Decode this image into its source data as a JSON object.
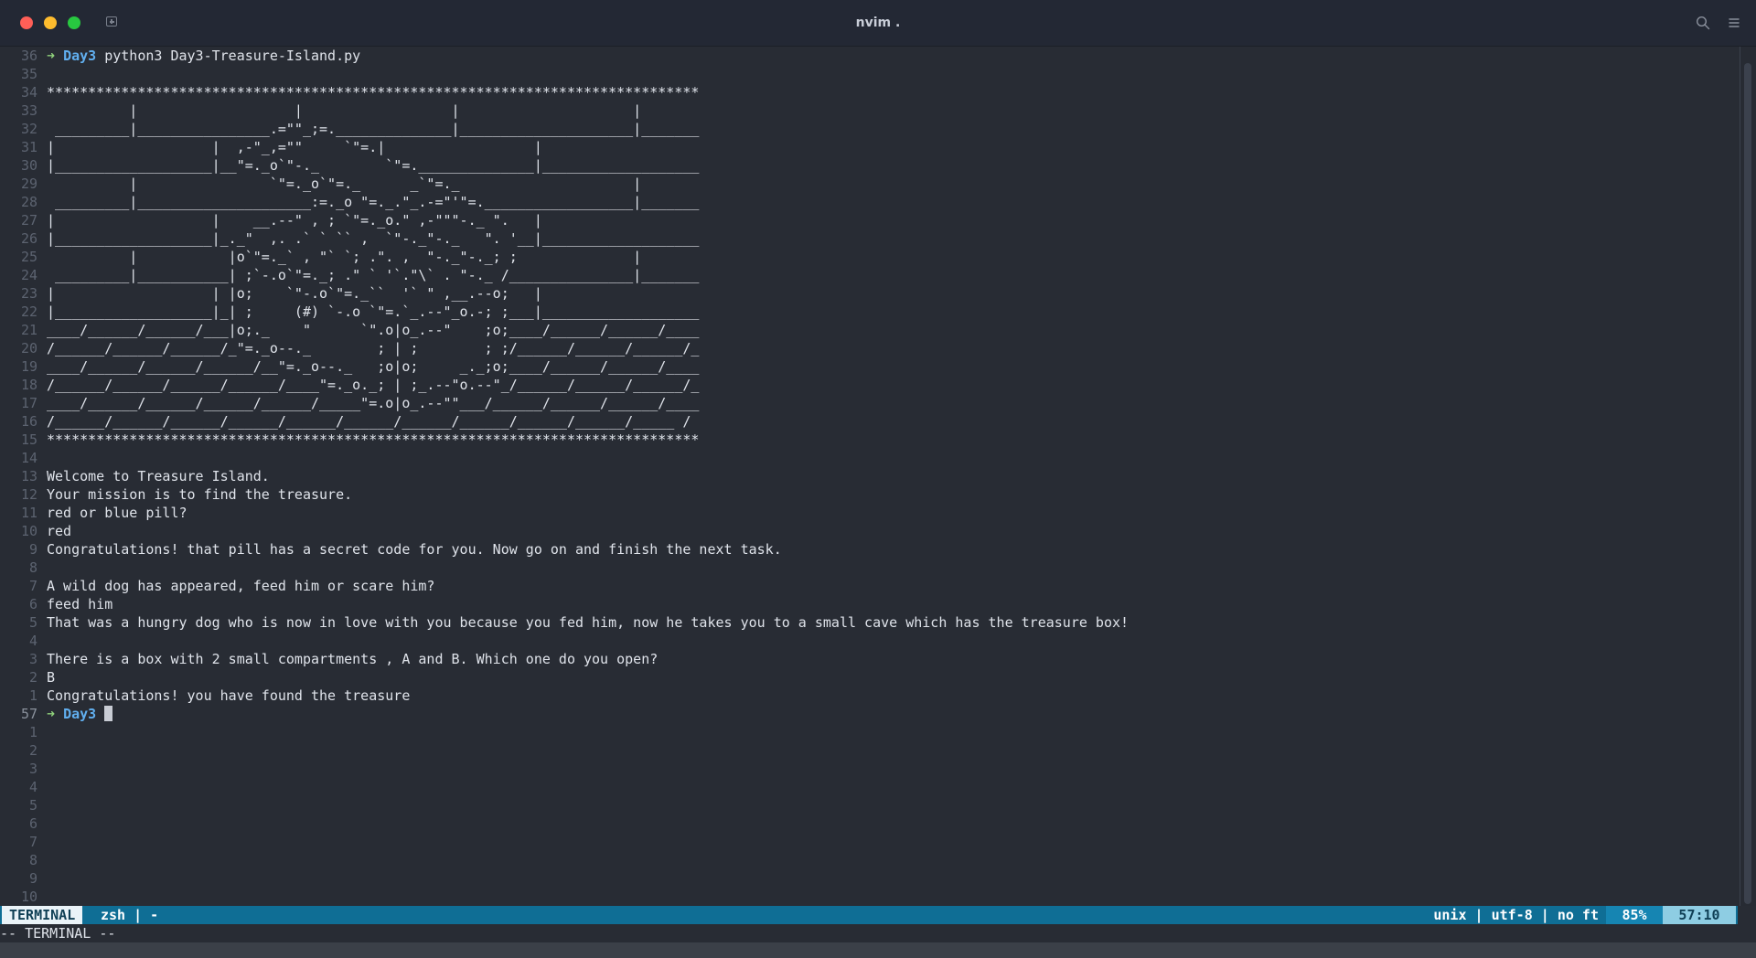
{
  "window": {
    "title": "nvim ."
  },
  "icons": {
    "close": "close-dot",
    "minimize": "minimize-dot",
    "maximize": "maximize-dot",
    "new_tab": "new-tab-icon",
    "search": "search-icon",
    "menu": "hamburger-menu-icon"
  },
  "colors": {
    "background": "#282c34",
    "prompt_arrow": "#8fd17b",
    "prompt_dir": "#61afef",
    "statusline": "#0f6e95"
  },
  "terminal": {
    "lines": [
      {
        "n": "36",
        "prompt": true,
        "arrow": "➜",
        "dir": "Day3",
        "text": "python3 Day3-Treasure-Island.py"
      },
      {
        "n": "35",
        "text": ""
      },
      {
        "n": "34",
        "text": "*******************************************************************************"
      },
      {
        "n": "33",
        "text": "          |                   |                  |                     |"
      },
      {
        "n": "32",
        "text": " _________|________________.=\"\"_;=.______________|_____________________|_______"
      },
      {
        "n": "31",
        "text": "|                   |  ,-\"_,=\"\"     `\"=.|                  |"
      },
      {
        "n": "30",
        "text": "|___________________|__\"=._o`\"-._        `\"=.______________|___________________"
      },
      {
        "n": "29",
        "text": "          |                `\"=._o`\"=._      _`\"=._                     |"
      },
      {
        "n": "28",
        "text": " _________|_____________________:=._o \"=._.\"_.-=\"'\"=.__________________|_______"
      },
      {
        "n": "27",
        "text": "|                   |    __.--\" , ; `\"=._o.\" ,-\"\"\"-._ \".   |"
      },
      {
        "n": "26",
        "text": "|___________________|_._\"  ,. .` ` `` ,  `\"-._\"-._   \". '__|___________________"
      },
      {
        "n": "25",
        "text": "          |           |o`\"=._` , \"` `; .\". ,  \"-._\"-._; ;              |"
      },
      {
        "n": "24",
        "text": " _________|___________| ;`-.o`\"=._; .\" ` '`.\"\\` . \"-._ /_______________|_______"
      },
      {
        "n": "23",
        "text": "|                   | |o;    `\"-.o`\"=._``  '` \" ,__.--o;   |"
      },
      {
        "n": "22",
        "text": "|___________________|_| ;     (#) `-.o `\"=.`_.--\"_o.-; ;___|___________________"
      },
      {
        "n": "21",
        "text": "____/______/______/___|o;._    \"      `\".o|o_.--\"    ;o;____/______/______/____"
      },
      {
        "n": "20",
        "text": "/______/______/______/_\"=._o--._        ; | ;        ; ;/______/______/______/_"
      },
      {
        "n": "19",
        "text": "____/______/______/______/__\"=._o--._   ;o|o;     _._;o;____/______/______/____"
      },
      {
        "n": "18",
        "text": "/______/______/______/______/____\"=._o._; | ;_.--\"o.--\"_/______/______/______/_"
      },
      {
        "n": "17",
        "text": "____/______/______/______/______/_____\"=.o|o_.--\"\"___/______/______/______/____"
      },
      {
        "n": "16",
        "text": "/______/______/______/______/______/______/______/______/______/______/_____ /"
      },
      {
        "n": "15",
        "text": "*******************************************************************************"
      },
      {
        "n": "14",
        "text": ""
      },
      {
        "n": "13",
        "text": "Welcome to Treasure Island."
      },
      {
        "n": "12",
        "text": "Your mission is to find the treasure."
      },
      {
        "n": "11",
        "text": "red or blue pill?"
      },
      {
        "n": "10",
        "text": "red"
      },
      {
        "n": "9",
        "text": "Congratulations! that pill has a secret code for you. Now go on and finish the next task."
      },
      {
        "n": "8",
        "text": ""
      },
      {
        "n": "7",
        "text": "A wild dog has appeared, feed him or scare him?"
      },
      {
        "n": "6",
        "text": "feed him"
      },
      {
        "n": "5",
        "text": "That was a hungry dog who is now in love with you because you fed him, now he takes you to a small cave which has the treasure box!"
      },
      {
        "n": "4",
        "text": ""
      },
      {
        "n": "3",
        "text": "There is a box with 2 small compartments , A and B. Which one do you open?"
      },
      {
        "n": "2",
        "text": "B"
      },
      {
        "n": "1",
        "text": "Congratulations! you have found the treasure"
      },
      {
        "n": "57",
        "prompt": true,
        "current": true,
        "arrow": "➜",
        "dir": "Day3",
        "text": ""
      },
      {
        "n": "1",
        "text": ""
      },
      {
        "n": "2",
        "text": ""
      },
      {
        "n": "3",
        "text": ""
      },
      {
        "n": "4",
        "text": ""
      },
      {
        "n": "5",
        "text": ""
      },
      {
        "n": "6",
        "text": ""
      },
      {
        "n": "7",
        "text": ""
      },
      {
        "n": "8",
        "text": ""
      },
      {
        "n": "9",
        "text": ""
      },
      {
        "n": "10",
        "text": ""
      }
    ]
  },
  "statusline": {
    "mode": "TERMINAL",
    "file": "zsh | -",
    "info": "unix | utf-8 | no ft",
    "percent": "85%",
    "position": "57:10"
  },
  "cmdline": {
    "text": "-- TERMINAL --"
  }
}
